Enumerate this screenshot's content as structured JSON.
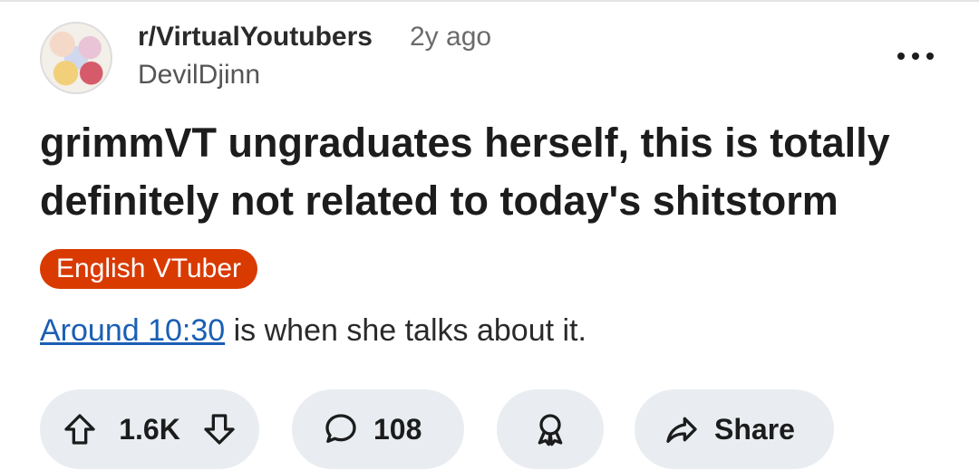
{
  "post": {
    "subreddit": "r/VirtualYoutubers",
    "age": "2y ago",
    "author": "DevilDjinn",
    "title": "grimmVT ungraduates herself, this is totally definitely not related to today's shitstorm",
    "flair": "English VTuber",
    "body_link_text": "Around 10:30",
    "body_rest": " is when she talks about it."
  },
  "actions": {
    "score": "1.6K",
    "comments": "108",
    "share_label": "Share"
  },
  "icons": {
    "more": "more-options-icon",
    "upvote": "upvote-arrow-icon",
    "downvote": "downvote-arrow-icon",
    "comment": "comment-bubble-icon",
    "award": "award-icon",
    "share": "share-arrow-icon"
  },
  "colors": {
    "flair_bg": "#d93a00",
    "link": "#1a5fb4",
    "pill_bg": "#e9edf1"
  }
}
